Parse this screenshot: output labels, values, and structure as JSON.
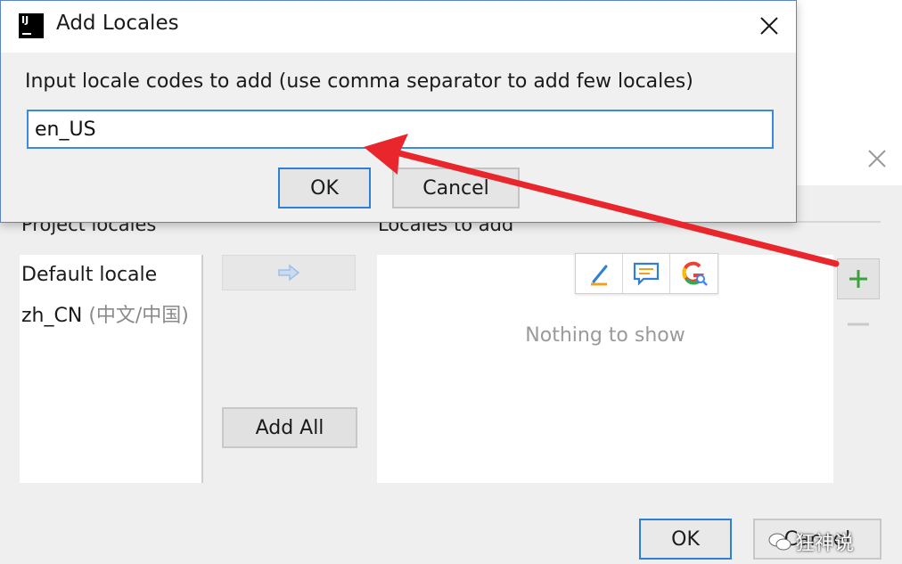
{
  "front_dialog": {
    "app_icon_text": "IJ",
    "title": "Add Locales",
    "instruction": "Input locale codes to add (use comma separator to add few locales)",
    "input_value": "en_US",
    "ok_label": "OK",
    "cancel_label": "Cancel"
  },
  "background_dialog": {
    "project_locales_title": "Project locales",
    "locales_to_add_title": "Locales to add",
    "project_locales": [
      {
        "code": "Default locale",
        "detail": ""
      },
      {
        "code": "zh_CN",
        "detail": "(中文/中国)"
      }
    ],
    "add_all_label": "Add All",
    "empty_text": "Nothing to show",
    "ok_label": "OK",
    "cancel_label": "Cancel"
  },
  "icons": {
    "arrow_right": "arrow-right-icon",
    "add": "plus-icon",
    "remove": "minus-icon",
    "edit": "pencil-icon",
    "comment": "comment-icon",
    "google_search": "google-search-icon"
  },
  "colors": {
    "accent": "#2f7fd2",
    "annotation": "#e8262b",
    "add_green": "#3aa13f"
  },
  "watermark": {
    "text": "狂神说"
  }
}
